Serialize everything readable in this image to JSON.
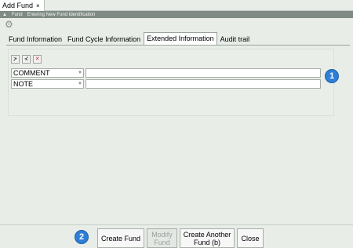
{
  "window": {
    "tab_title": "Add Fund",
    "close_glyph": "×"
  },
  "breadcrumb": {
    "segments": [
      "Fund",
      "Entering New Fund Identification"
    ]
  },
  "tabs": [
    {
      "label": "Fund Information",
      "active": false
    },
    {
      "label": "Fund Cycle Information",
      "active": false
    },
    {
      "label": "Extended Information",
      "active": true
    },
    {
      "label": "Audit trail",
      "active": false
    }
  ],
  "toolbar": {
    "icons": [
      "add-row-icon",
      "insert-row-icon",
      "delete-row-icon"
    ]
  },
  "extended_fields": [
    {
      "type": "COMMENT",
      "value": ""
    },
    {
      "type": "NOTE",
      "value": ""
    }
  ],
  "annotations": {
    "badge1": "1",
    "badge2": "2"
  },
  "buttons": {
    "create_fund": "Create Fund",
    "modify_fund_line1": "Modify",
    "modify_fund_line2": "Fund",
    "create_another_line1": "Create Another",
    "create_another_line2": "Fund (b)",
    "close": "Close"
  },
  "colors": {
    "badge": "#2f7ed8",
    "breadcrumb_bg": "#7f8b84",
    "window_bg": "#e8ede8"
  }
}
